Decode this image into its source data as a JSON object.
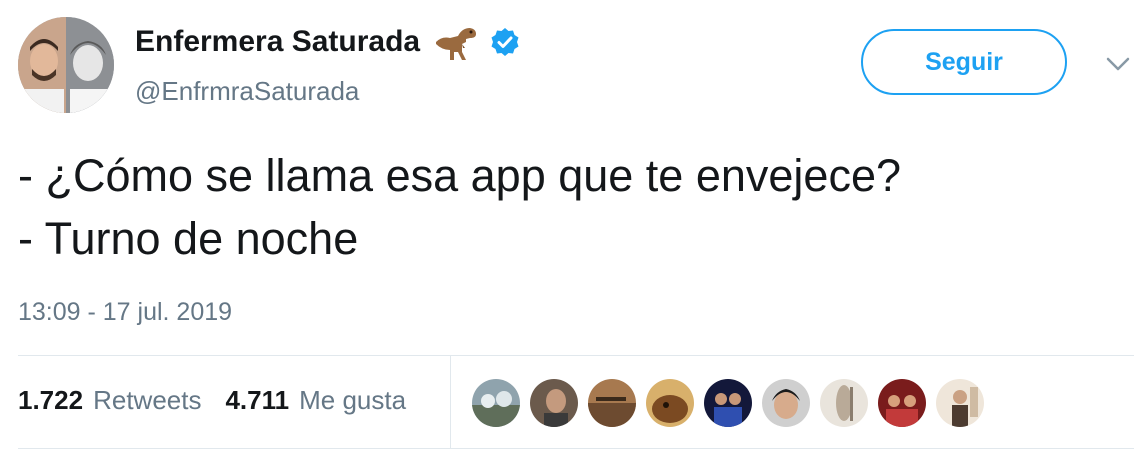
{
  "user": {
    "display_name": "Enfermera Saturada",
    "handle": "@EnfrmraSaturada",
    "badge_emoji_icon": "t-rex-emoji-icon",
    "verified_icon": "verified-badge-icon"
  },
  "follow_button": {
    "label": "Seguir"
  },
  "menu_icon": "chevron-down-icon",
  "tweet": {
    "lines": [
      "- ¿Cómo se llama esa app que te envejece?",
      "- Turno de noche"
    ],
    "timestamp": "13:09 - 17 jul. 2019"
  },
  "stats": {
    "retweets": {
      "count": "1.722",
      "label": "Retweets"
    },
    "likes": {
      "count": "4.711",
      "label": "Me gusta"
    }
  },
  "colors": {
    "accent": "#1da1f2",
    "text": "#14171a",
    "secondary_text": "#657786",
    "divider": "#e1e8ed"
  }
}
